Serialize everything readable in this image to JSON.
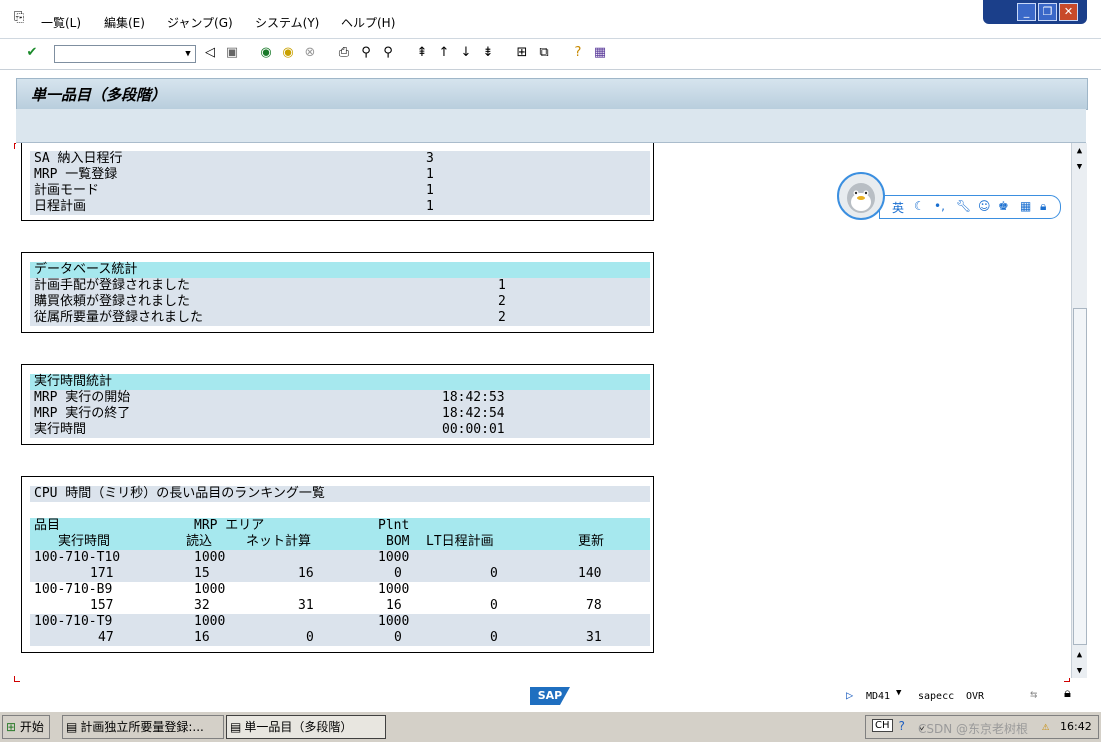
{
  "menu": {
    "items": [
      "一覧(L)",
      "編集(E)",
      "ジャンプ(G)",
      "システム(Y)",
      "ヘルプ(H)"
    ],
    "window_controls": {
      "minimize": "_",
      "restore": "❐",
      "close": "✕"
    }
  },
  "toolbar": {
    "icons": [
      "enter-check-icon",
      "back-icon",
      "save-icon",
      "green-back-icon",
      "exit-icon",
      "cancel-icon",
      "print-icon",
      "find-icon",
      "find-next-icon",
      "first-page-icon",
      "prev-page-icon",
      "next-page-icon",
      "last-page-icon",
      "create-session-icon",
      "shortcut-icon",
      "help-icon",
      "layout-icon"
    ]
  },
  "title": "単一品目（多段階）",
  "sections": {
    "top": {
      "rows": [
        {
          "label": "SA 納入日程行",
          "value": "3"
        },
        {
          "label": "MRP 一覧登録",
          "value": "1"
        },
        {
          "label": "計画モード",
          "value": "1"
        },
        {
          "label": "日程計画",
          "value": "1"
        }
      ]
    },
    "db_stats": {
      "header": "データベース統計",
      "rows": [
        {
          "label": "計画手配が登録されました",
          "value": "1"
        },
        {
          "label": "購買依頼が登録されました",
          "value": "2"
        },
        {
          "label": "従属所要量が登録されました",
          "value": "2"
        }
      ]
    },
    "runtime": {
      "header": "実行時間統計",
      "rows": [
        {
          "label": "MRP 実行の開始",
          "value": "18:42:53"
        },
        {
          "label": "MRP 実行の終了",
          "value": "18:42:54"
        },
        {
          "label": "実行時間",
          "value": "00:00:01"
        }
      ]
    },
    "ranking": {
      "title": "CPU 時間（ミリ秒）の長い品目のランキング一覧",
      "header1": {
        "c1": "品目",
        "c2": "MRP エリア",
        "c3": "Plnt"
      },
      "header2": {
        "c1": "実行時間",
        "c2": "読込",
        "c3": "ネット計算",
        "c4": "BOM",
        "c5": "LT日程計画",
        "c6": "更新"
      },
      "items": [
        {
          "material": "100-710-T10",
          "mrp_area": "1000",
          "plant": "1000",
          "time": "171",
          "read": "15",
          "net": "16",
          "bom": "0",
          "lt": "0",
          "update": "140"
        },
        {
          "material": "100-710-B9",
          "mrp_area": "1000",
          "plant": "1000",
          "time": "157",
          "read": "32",
          "net": "31",
          "bom": "16",
          "lt": "0",
          "update": "78"
        },
        {
          "material": "100-710-T9",
          "mrp_area": "1000",
          "plant": "1000",
          "time": "47",
          "read": "16",
          "net": "0",
          "bom": "0",
          "lt": "0",
          "update": "31"
        }
      ]
    }
  },
  "statusbar": {
    "logo": "SAP",
    "transaction": "MD41",
    "server": "sapecc",
    "mode": "OVR"
  },
  "taskbar": {
    "start": "开始",
    "tasks": [
      "計画独立所要量登録:...",
      "単一品目（多段階）"
    ],
    "tray_lang": "CH",
    "clock": "16:42",
    "watermark": "CSDN @东京老树根"
  },
  "qq_widget": {
    "lang": "英"
  }
}
